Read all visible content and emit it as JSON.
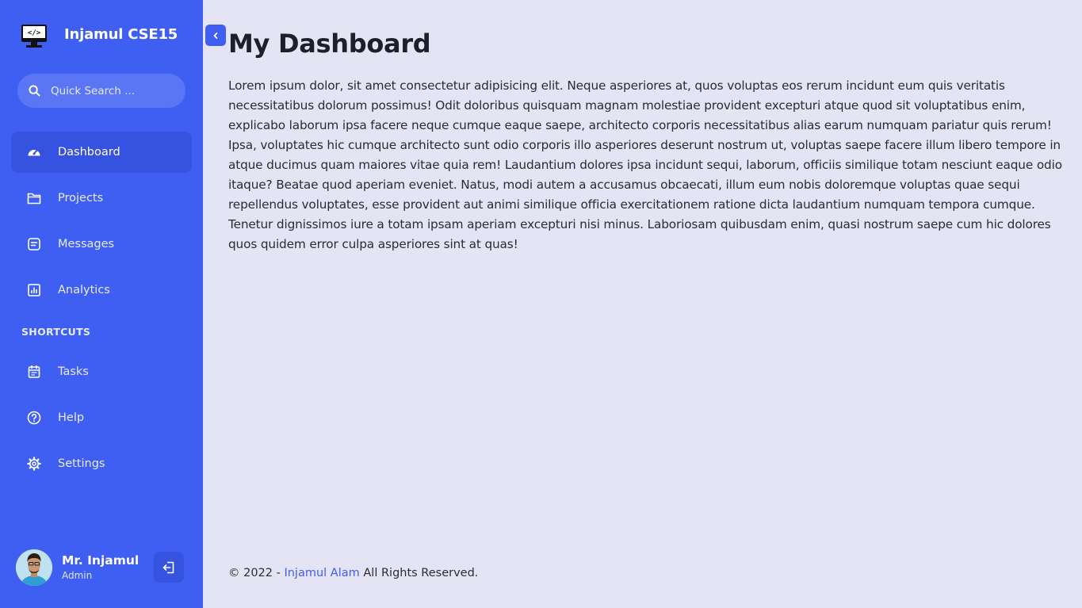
{
  "brand": {
    "name": "Injamul CSE15",
    "logo_icon": "monitor-code-icon"
  },
  "search": {
    "placeholder": "Quick Search ...",
    "value": ""
  },
  "nav": {
    "items": [
      {
        "label": "Dashboard",
        "icon": "gauge-icon",
        "active": true
      },
      {
        "label": "Projects",
        "icon": "folder-icon"
      },
      {
        "label": "Messages",
        "icon": "message-icon"
      },
      {
        "label": "Analytics",
        "icon": "chart-icon"
      }
    ],
    "shortcuts_title": "SHORTCUTS",
    "shortcuts": [
      {
        "label": "Tasks",
        "icon": "calendar-icon"
      },
      {
        "label": "Help",
        "icon": "help-icon"
      },
      {
        "label": "Settings",
        "icon": "gear-icon"
      }
    ]
  },
  "profile": {
    "name": "Mr. Injamul",
    "role": "Admin"
  },
  "main": {
    "title": "My Dashboard",
    "body": "Lorem ipsum dolor, sit amet consectetur adipisicing elit. Neque asperiores at, quos voluptas eos rerum incidunt eum quis veritatis necessitatibus dolorum possimus! Odit doloribus quisquam magnam molestiae provident excepturi atque quod sit voluptatibus enim, explicabo laborum ipsa facere neque cumque eaque saepe, architecto corporis necessitatibus alias earum numquam pariatur quis rerum! Ipsa, voluptates hic cumque architecto sunt odio corporis illo asperiores deserunt nostrum ut, voluptas saepe facere illum libero tempore in atque ducimus quam maiores vitae quia rem! Laudantium dolores ipsa incidunt sequi, laborum, officiis similique totam nesciunt eaque odio itaque? Beatae quod aperiam eveniet. Natus, modi autem a accusamus obcaecati, illum eum nobis doloremque voluptas quae sequi repellendus voluptates, esse provident aut animi similique officia exercitationem ratione dicta laudantium numquam tempora cumque. Tenetur dignissimos iure a totam ipsam aperiam excepturi nisi minus. Laboriosam quibusdam enim, quasi nostrum saepe cum hic dolores quos quidem error culpa asperiores sint at quas!"
  },
  "footer": {
    "prefix": "© 2022 - ",
    "link": "Injamul Alam",
    "suffix": " All Rights Reserved."
  },
  "colors": {
    "sidebar": "#3f5ef2",
    "sidebar_active": "#3552e0",
    "search_bg": "#5a76f5",
    "page_bg": "#e4e4f5",
    "link": "#3f5ef2"
  }
}
